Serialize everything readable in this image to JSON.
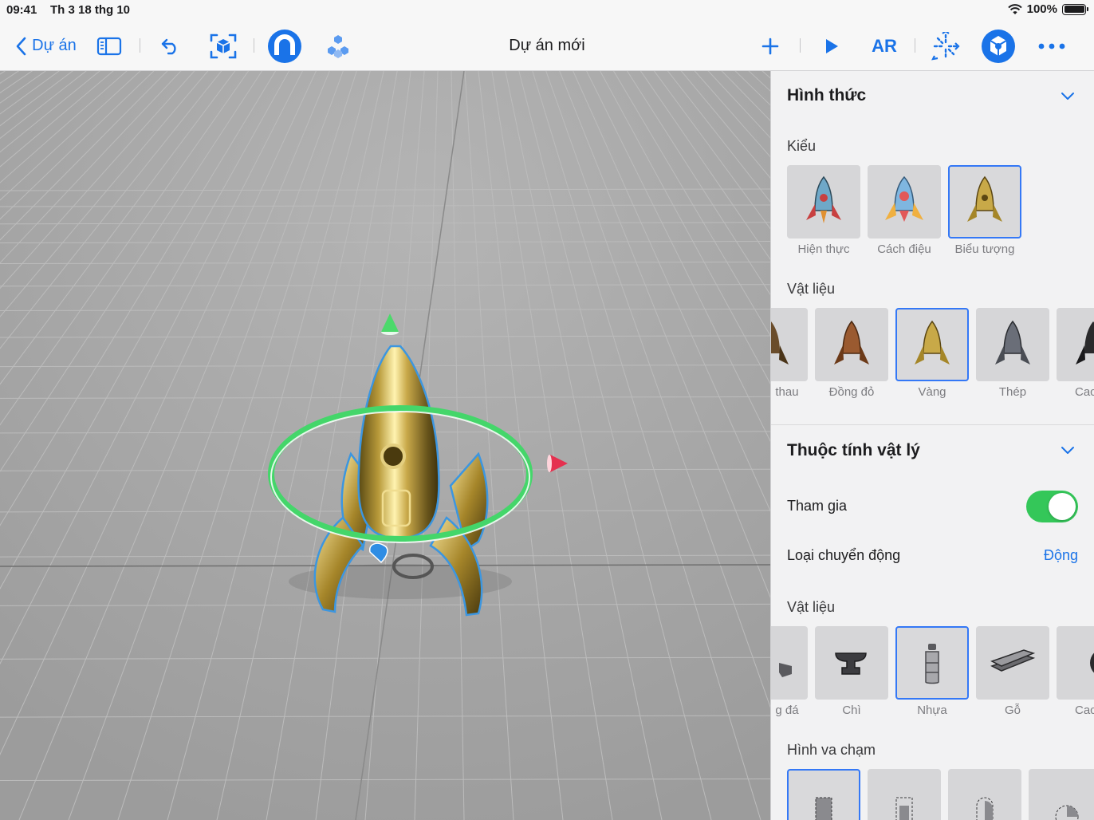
{
  "status_bar": {
    "time": "09:41",
    "date": "Th 3 18 thg 10",
    "battery": "100%"
  },
  "toolbar": {
    "back_label": "Dự án",
    "title": "Dự án mới",
    "ar_label": "AR"
  },
  "panel": {
    "appearance": {
      "title": "Hình thức",
      "style_label": "Kiểu",
      "styles": [
        "Hiện thực",
        "Cách điệu",
        "Biểu tượng"
      ],
      "selected_style": "Biểu tượng",
      "material_label": "Vật liệu",
      "materials": [
        "thau",
        "Đồng đỏ",
        "Vàng",
        "Thép",
        "Cac"
      ],
      "selected_material": "Vàng"
    },
    "physics": {
      "title": "Thuộc tính vật lý",
      "participates_label": "Tham gia",
      "participates": true,
      "motion_type_label": "Loại chuyển động",
      "motion_type_value": "Động",
      "material_label": "Vật liệu",
      "materials": [
        "g đá",
        "Chì",
        "Nhựa",
        "Gỗ",
        "Cac"
      ],
      "selected_material": "Nhựa",
      "collision_label": "Hình va chạm"
    }
  },
  "colors": {
    "accent": "#1a73e8",
    "selection": "#3478f6",
    "toggle_on": "#34c759",
    "gizmo_y": "#4cd96b",
    "gizmo_x": "#e5304f",
    "gizmo_z": "#2f8de4",
    "rotation_ring": "#44d66a"
  }
}
